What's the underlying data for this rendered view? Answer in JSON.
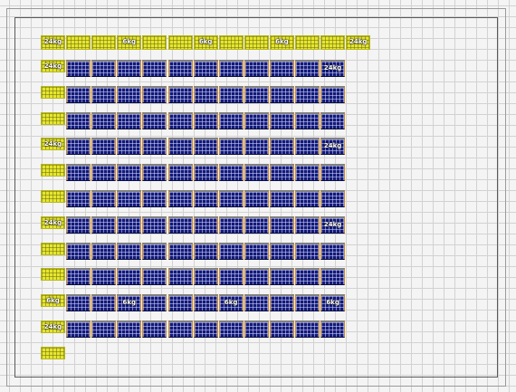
{
  "layout_grid": {
    "columns": 12,
    "panel_rows": 11,
    "panel_color": "#121a78",
    "ballast_color": "#e6e62e",
    "frame_color": "#5a5a5a",
    "top_ballast_labels": [
      {
        "col": 0,
        "text": "24kg"
      },
      {
        "col": 3,
        "text": "6kg"
      },
      {
        "col": 6,
        "text": "6kg"
      },
      {
        "col": 9,
        "text": "6kg"
      },
      {
        "col": 12,
        "text": "24kg"
      }
    ],
    "left_ballast_labels": [
      {
        "row": 1,
        "text": "24kg"
      },
      {
        "row": 4,
        "text": "24kg"
      },
      {
        "row": 7,
        "text": "24kg"
      },
      {
        "row": 10,
        "text": "6kg"
      },
      {
        "row": 11,
        "text": "24kg"
      }
    ],
    "panel_labels": [
      {
        "row": 1,
        "col": 11,
        "text": "24kg"
      },
      {
        "row": 4,
        "col": 11,
        "text": "24kg"
      },
      {
        "row": 7,
        "col": 11,
        "text": "24kg"
      },
      {
        "row": 10,
        "col": 3,
        "text": "6kg"
      },
      {
        "row": 10,
        "col": 7,
        "text": "6kg"
      },
      {
        "row": 10,
        "col": 11,
        "text": "6kg"
      }
    ]
  }
}
